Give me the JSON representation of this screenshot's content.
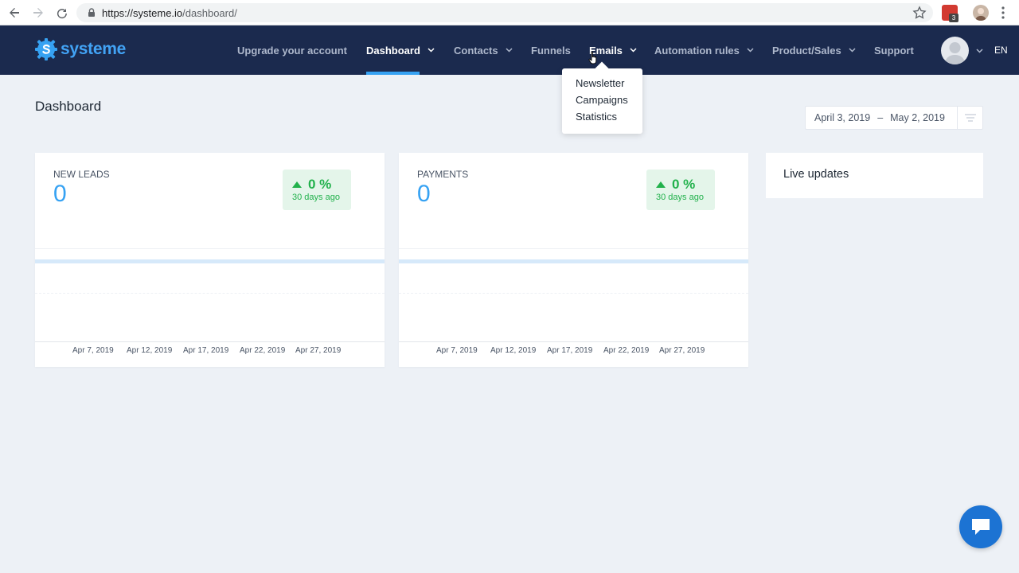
{
  "browser": {
    "url_scheme": "https://systeme.io",
    "url_path": "/dashboard/",
    "extension_badge": "3"
  },
  "nav": {
    "brand": "systeme",
    "items": [
      {
        "label": "Upgrade your account",
        "has_dropdown": false,
        "active": false
      },
      {
        "label": "Dashboard",
        "has_dropdown": true,
        "active": true
      },
      {
        "label": "Contacts",
        "has_dropdown": true,
        "active": false
      },
      {
        "label": "Funnels",
        "has_dropdown": false,
        "active": false
      },
      {
        "label": "Emails",
        "has_dropdown": true,
        "active": false,
        "hovered": true
      },
      {
        "label": "Automation rules",
        "has_dropdown": true,
        "active": false
      },
      {
        "label": "Product/Sales",
        "has_dropdown": true,
        "active": false
      },
      {
        "label": "Support",
        "has_dropdown": false,
        "active": false
      }
    ],
    "language": "EN"
  },
  "emails_dropdown": {
    "items": [
      "Newsletter",
      "Campaigns",
      "Statistics"
    ]
  },
  "page": {
    "title": "Dashboard",
    "date_from": "April 3, 2019",
    "date_separator": "–",
    "date_to": "May 2, 2019"
  },
  "cards": [
    {
      "label": "NEW LEADS",
      "value": "0",
      "change": "0 %",
      "change_period": "30 days ago",
      "x_ticks": [
        "Apr 7, 2019",
        "Apr 12, 2019",
        "Apr 17, 2019",
        "Apr 22, 2019",
        "Apr 27, 2019"
      ]
    },
    {
      "label": "PAYMENTS",
      "value": "0",
      "change": "0 %",
      "change_period": "30 days ago",
      "x_ticks": [
        "Apr 7, 2019",
        "Apr 12, 2019",
        "Apr 17, 2019",
        "Apr 22, 2019",
        "Apr 27, 2019"
      ]
    }
  ],
  "live_updates": {
    "title": "Live updates"
  },
  "colors": {
    "navbar": "#1b2a4e",
    "accent": "#36a2f3",
    "positive": "#22b14c",
    "chat": "#1c73d3"
  }
}
